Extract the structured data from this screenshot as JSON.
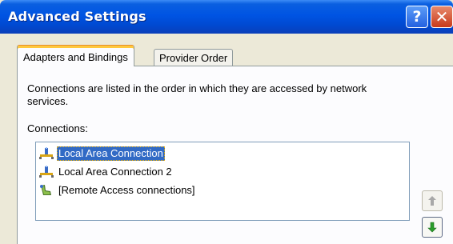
{
  "window": {
    "title": "Advanced Settings",
    "help_glyph": "?",
    "close_glyph": "✕"
  },
  "tabs": [
    {
      "label": "Adapters and Bindings",
      "active": true
    },
    {
      "label": "Provider Order",
      "active": false
    }
  ],
  "pane": {
    "description": "Connections are listed in the order in which they are accessed by network services.",
    "connections_label": "Connections:"
  },
  "connections": [
    {
      "label": "Local Area Connection",
      "icon": "network-adapter-icon",
      "selected": true
    },
    {
      "label": "Local Area Connection 2",
      "icon": "network-adapter-icon",
      "selected": false
    },
    {
      "label": "[Remote Access connections]",
      "icon": "remote-access-icon",
      "selected": false
    }
  ],
  "buttons": {
    "move_up": {
      "icon": "arrow-up-icon",
      "enabled": false,
      "color": "#a8a8a8"
    },
    "move_down": {
      "icon": "arrow-down-icon",
      "enabled": true,
      "color": "#2a9d2a"
    }
  },
  "colors": {
    "titlebar": "#0054e3",
    "selection": "#316ac5",
    "active_tab_accent": "#ffc83c"
  }
}
